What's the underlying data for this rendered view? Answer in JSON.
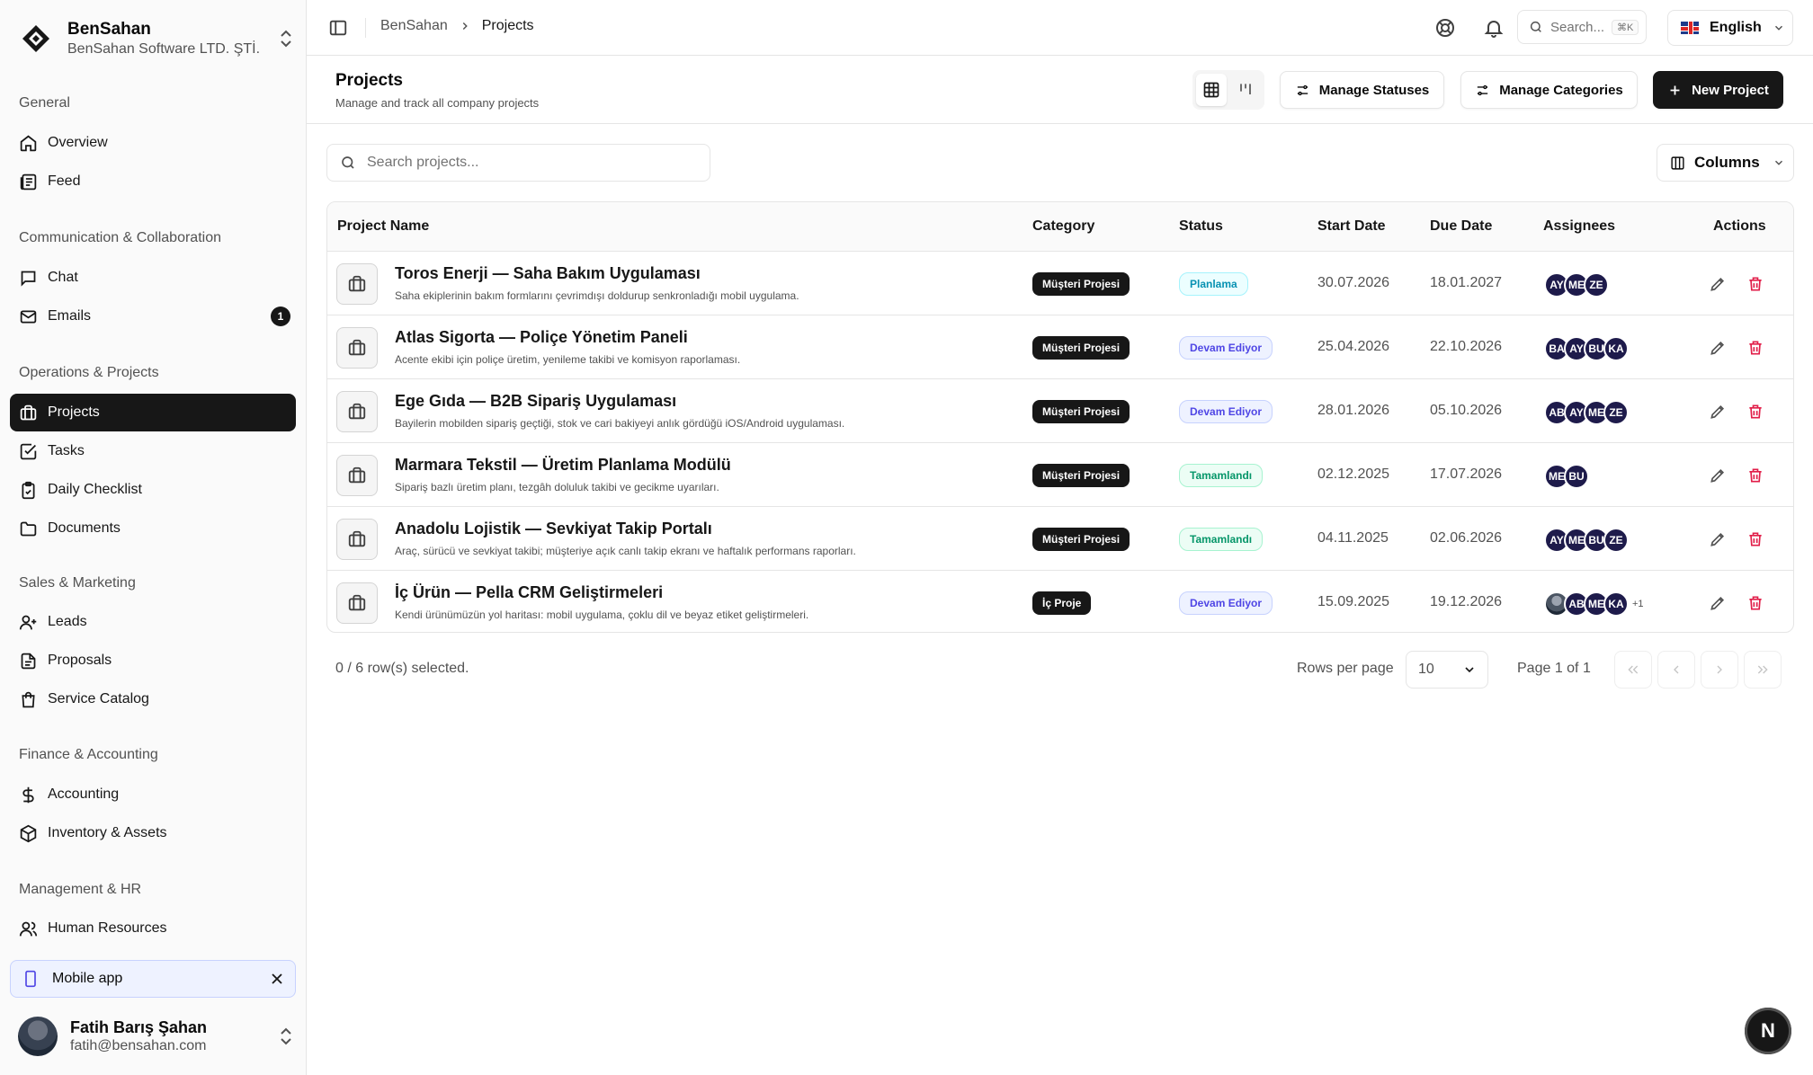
{
  "org": {
    "name": "BenSahan",
    "subtitle": "BenSahan Software LTD. ŞTİ."
  },
  "sidebar": {
    "sections": [
      {
        "label": "General"
      },
      {
        "label": "Communication & Collaboration"
      },
      {
        "label": "Operations & Projects"
      },
      {
        "label": "Sales & Marketing"
      },
      {
        "label": "Finance & Accounting"
      },
      {
        "label": "Management & HR"
      }
    ],
    "items": [
      {
        "label": "Overview",
        "icon": "home-icon"
      },
      {
        "label": "Feed",
        "icon": "newspaper-icon"
      },
      {
        "label": "Chat",
        "icon": "chat-icon"
      },
      {
        "label": "Emails",
        "icon": "mail-icon",
        "badge": "1"
      },
      {
        "label": "Projects",
        "icon": "briefcase-icon",
        "active": true
      },
      {
        "label": "Tasks",
        "icon": "check-square-icon"
      },
      {
        "label": "Daily Checklist",
        "icon": "clipboard-check-icon"
      },
      {
        "label": "Documents",
        "icon": "folder-icon"
      },
      {
        "label": "Leads",
        "icon": "user-plus-icon"
      },
      {
        "label": "Proposals",
        "icon": "file-text-icon"
      },
      {
        "label": "Service Catalog",
        "icon": "shopping-bag-icon"
      },
      {
        "label": "Accounting",
        "icon": "dollar-icon"
      },
      {
        "label": "Inventory & Assets",
        "icon": "package-icon"
      },
      {
        "label": "Human Resources",
        "icon": "users-icon"
      }
    ],
    "mobile_app": "Mobile app"
  },
  "user": {
    "name": "Fatih Barış Şahan",
    "email": "fatih@bensahan.com"
  },
  "topbar": {
    "breadcrumb": [
      "BenSahan",
      "Projects"
    ],
    "search_placeholder": "Search...",
    "search_shortcut": "⌘K",
    "language": "English"
  },
  "page": {
    "title": "Projects",
    "subtitle": "Manage and track all company projects",
    "manage_statuses": "Manage Statuses",
    "manage_categories": "Manage Categories",
    "new_project": "New Project",
    "search_placeholder": "Search projects...",
    "columns_button": "Columns"
  },
  "table": {
    "headers": [
      "Project Name",
      "Category",
      "Status",
      "Start Date",
      "Due Date",
      "Assignees",
      "Actions"
    ],
    "rows": [
      {
        "name": "Toros Enerji — Saha Bakım Uygulaması",
        "desc": "Saha ekiplerinin bakım formlarını çevrimdışı doldurup senkronladığı mobil uygulama.",
        "category": "Müşteri Projesi",
        "status": "Planlama",
        "status_kind": "plan",
        "start": "30.07.2026",
        "due": "18.01.2027",
        "assignees": [
          "AY",
          "ME",
          "ZE"
        ],
        "more": ""
      },
      {
        "name": "Atlas Sigorta — Poliçe Yönetim Paneli",
        "desc": "Acente ekibi için poliçe üretim, yenileme takibi ve komisyon raporlaması.",
        "category": "Müşteri Projesi",
        "status": "Devam Ediyor",
        "status_kind": "prog",
        "start": "25.04.2026",
        "due": "22.10.2026",
        "assignees": [
          "BA",
          "AY",
          "BU",
          "KA"
        ],
        "more": ""
      },
      {
        "name": "Ege Gıda — B2B Sipariş Uygulaması",
        "desc": "Bayilerin mobilden sipariş geçtiği, stok ve cari bakiyeyi anlık gördüğü iOS/Android uygulaması.",
        "category": "Müşteri Projesi",
        "status": "Devam Ediyor",
        "status_kind": "prog",
        "start": "28.01.2026",
        "due": "05.10.2026",
        "assignees": [
          "AB",
          "AY",
          "ME",
          "ZE"
        ],
        "more": ""
      },
      {
        "name": "Marmara Tekstil — Üretim Planlama Modülü",
        "desc": "Sipariş bazlı üretim planı, tezgâh doluluk takibi ve gecikme uyarıları.",
        "category": "Müşteri Projesi",
        "status": "Tamamlandı",
        "status_kind": "done",
        "start": "02.12.2025",
        "due": "17.07.2026",
        "assignees": [
          "ME",
          "BU"
        ],
        "more": ""
      },
      {
        "name": "Anadolu Lojistik — Sevkiyat Takip Portalı",
        "desc": "Araç, sürücü ve sevkiyat takibi; müşteriye açık canlı takip ekranı ve haftalık performans raporları.",
        "category": "Müşteri Projesi",
        "status": "Tamamlandı",
        "status_kind": "done",
        "start": "04.11.2025",
        "due": "02.06.2026",
        "assignees": [
          "AY",
          "ME",
          "BU",
          "ZE"
        ],
        "more": ""
      },
      {
        "name": "İç Ürün — Pella CRM Geliştirmeleri",
        "desc": "Kendi ürünümüzün yol haritası: mobil uygulama, çoklu dil ve beyaz etiket geliştirmeleri.",
        "category": "İç Proje",
        "status": "Devam Ediyor",
        "status_kind": "prog",
        "start": "15.09.2025",
        "due": "19.12.2026",
        "assignees": [
          "",
          "AB",
          "ME",
          "KA"
        ],
        "more": "+1"
      }
    ]
  },
  "footer": {
    "selected": "0 / 6 row(s) selected.",
    "rows_per_page_label": "Rows per page",
    "rows_per_page": "10",
    "page_of": "Page 1 of 1"
  },
  "fab": "N"
}
